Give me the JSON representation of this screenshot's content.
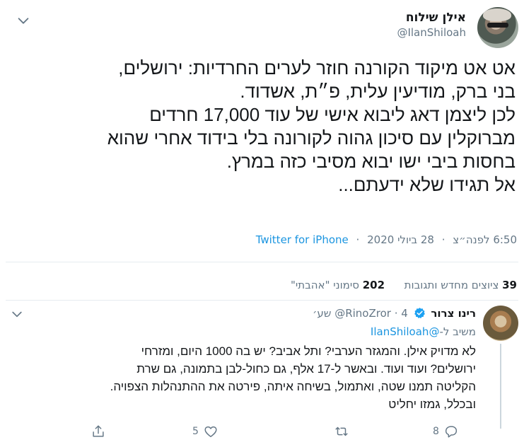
{
  "tweet": {
    "author": {
      "display_name": "אילן שילוח",
      "handle": "@IlanShiloah"
    },
    "text_lines": [
      "אט אט מיקוד הקורנה חוזר לערים החרדיות: ירושלים,",
      "בני ברק, מודיעין עלית, פ״ת, אשדוד.",
      "לכן ליצמן דאג ליבוא אישי של עוד 17,000 חרדים",
      "מברוקלין עם סיכון גהוה לקורונה בלי בידוד אחרי שהוא",
      "בחסות ביבי ישו יבוא מסיבי כזה במרץ.",
      "אל תגידו שלא ידעתם..."
    ],
    "time": "6:50 לפנה״צ",
    "date": "28 ביולי 2020",
    "source": "Twitter for iPhone",
    "separator": "·"
  },
  "stats": {
    "retweets_count": "39",
    "retweets_label": "ציוצים מחדש ותגובות",
    "likes_count": "202",
    "likes_label": "סימוני \"אהבתי\""
  },
  "reply": {
    "author": {
      "display_name": "רינו צרור",
      "handle": "@RinoZror",
      "verified": true
    },
    "time_ago": "4 שע׳",
    "separator": "·",
    "replying_prefix": "משיב ל-",
    "replying_to": "@IlanShiloah",
    "text_lines": [
      "לא מדויק אילן. והמגזר הערבי? ותל אביב? יש בה 1000 היום, ומזרחי",
      "ירושלים? ועוד ועוד. ובאשר ל-17 אלף, גם כחול-לבן בתמונה, גם שרת",
      "הקליטה תמנו שטה, ואתמול, בשיחה איתה, פירטה את ההתנהלות הצפויה.",
      "ובכלל, גמזו יחליט"
    ],
    "actions": {
      "reply_count": "8",
      "retweet_count": "",
      "like_count": "5"
    }
  },
  "colors": {
    "accent": "#1b95e0",
    "secondary_text": "#657786",
    "primary_text": "#14171a",
    "divider": "#e6ecf0",
    "verified": "#1da1f2"
  },
  "icons": {
    "more": "chevron-down-icon",
    "verified": "verified-badge-icon",
    "reply": "reply-icon",
    "retweet": "retweet-icon",
    "like": "heart-icon",
    "share": "share-icon"
  }
}
